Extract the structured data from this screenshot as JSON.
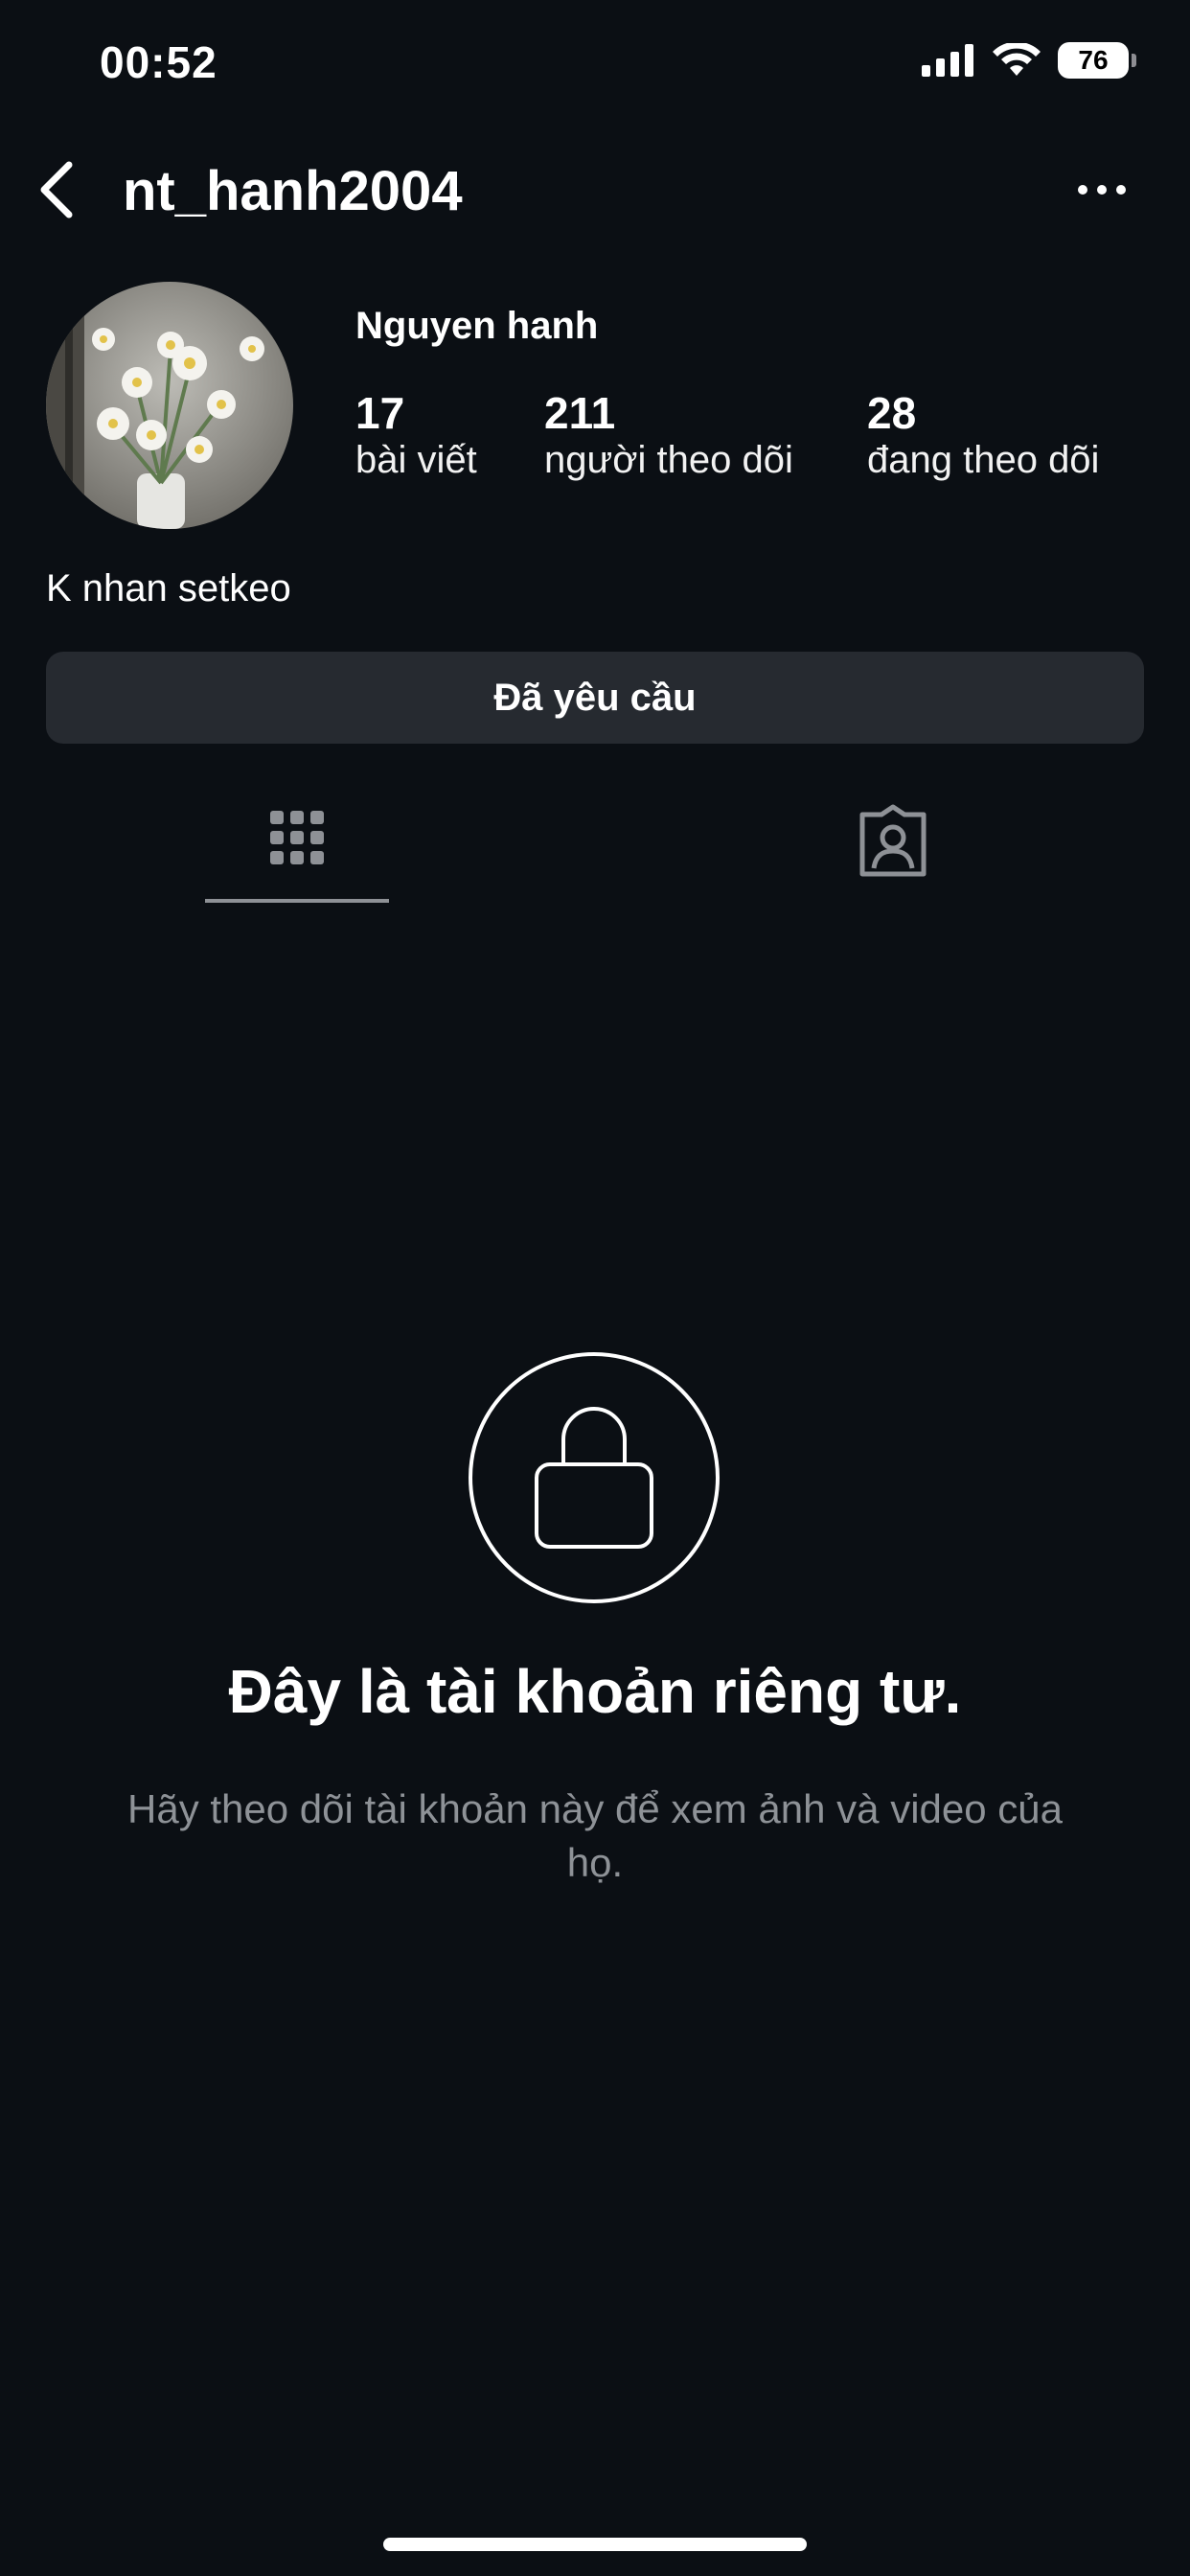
{
  "status_bar": {
    "time": "00:52",
    "battery": "76",
    "icons": [
      "signal-icon",
      "wifi-icon",
      "battery-icon"
    ]
  },
  "header": {
    "username": "nt_hanh2004",
    "back_icon": "chevron-left-icon",
    "more_icon": "more-horizontal-icon"
  },
  "profile": {
    "display_name": "Nguyen hanh",
    "stats": [
      {
        "value": "17",
        "label": "bài viết"
      },
      {
        "value": "211",
        "label": "người theo dõi"
      },
      {
        "value": "28",
        "label": "đang theo dõi"
      }
    ],
    "bio": "K nhan setkeo",
    "requested_label": "Đã yêu cầu"
  },
  "tabs": [
    {
      "icon": "grid-icon",
      "active": true
    },
    {
      "icon": "tagged-person-icon",
      "active": false
    }
  ],
  "private_notice": {
    "title": "Đây là tài khoản riêng tư.",
    "subtitle": "Hãy theo dõi tài khoản này để xem ảnh và video của họ.",
    "icon": "lock-icon"
  },
  "colors": {
    "background": "#0b0f14",
    "button": "#262a30",
    "muted_text": "#8e9297"
  }
}
